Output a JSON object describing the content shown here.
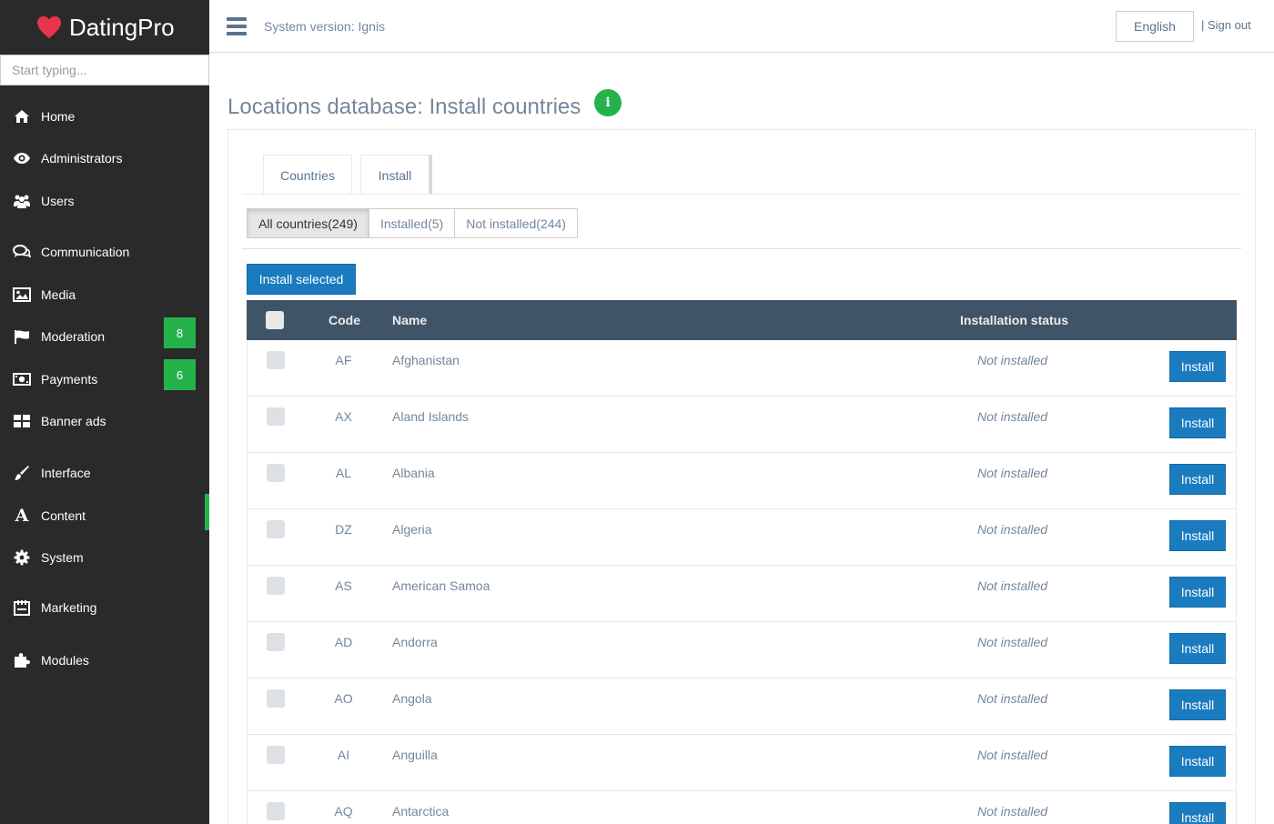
{
  "brand": {
    "name": "DatingPro"
  },
  "sidebar": {
    "search_placeholder": "Start typing...",
    "items": [
      {
        "label": "Home",
        "icon": "home-icon"
      },
      {
        "label": "Administrators",
        "icon": "eye-icon"
      },
      {
        "label": "Users",
        "icon": "users-icon"
      },
      {
        "label": "Communication",
        "icon": "chat-icon"
      },
      {
        "label": "Media",
        "icon": "image-icon"
      },
      {
        "label": "Moderation",
        "icon": "flag-icon",
        "badge": "8"
      },
      {
        "label": "Payments",
        "icon": "money-icon",
        "badge": "6"
      },
      {
        "label": "Banner ads",
        "icon": "grid-icon"
      },
      {
        "label": "Interface",
        "icon": "brush-icon"
      },
      {
        "label": "Content",
        "icon": "font-icon",
        "active": true
      },
      {
        "label": "System",
        "icon": "gear-icon"
      },
      {
        "label": "Marketing",
        "icon": "calendar-icon"
      },
      {
        "label": "Modules",
        "icon": "puzzle-icon"
      }
    ]
  },
  "header": {
    "system_version": "System version: Ignis",
    "language": "English",
    "sign_out": "| Sign out"
  },
  "page": {
    "title": "Locations database: Install countries",
    "info_icon_glyph": "i",
    "tabs": [
      {
        "label": "Countries"
      },
      {
        "label": "Install"
      }
    ],
    "filters": [
      {
        "label": "All countries(249)",
        "active": true
      },
      {
        "label": "Installed(5)"
      },
      {
        "label": "Not installed(244)"
      }
    ],
    "install_selected": "Install selected"
  },
  "table": {
    "columns": {
      "code": "Code",
      "name": "Name",
      "status": "Installation status"
    },
    "rows": [
      {
        "code": "AF",
        "name": "Afghanistan",
        "status": "Not installed",
        "action": "Install"
      },
      {
        "code": "AX",
        "name": "Aland Islands",
        "status": "Not installed",
        "action": "Install"
      },
      {
        "code": "AL",
        "name": "Albania",
        "status": "Not installed",
        "action": "Install"
      },
      {
        "code": "DZ",
        "name": "Algeria",
        "status": "Not installed",
        "action": "Install"
      },
      {
        "code": "AS",
        "name": "American Samoa",
        "status": "Not installed",
        "action": "Install"
      },
      {
        "code": "AD",
        "name": "Andorra",
        "status": "Not installed",
        "action": "Install"
      },
      {
        "code": "AO",
        "name": "Angola",
        "status": "Not installed",
        "action": "Install"
      },
      {
        "code": "AI",
        "name": "Anguilla",
        "status": "Not installed",
        "action": "Install"
      },
      {
        "code": "AQ",
        "name": "Antarctica",
        "status": "Not installed",
        "action": "Install"
      }
    ]
  },
  "colors": {
    "sidebar_bg": "#2a2a2a",
    "accent_green": "#26b24b",
    "primary_blue": "#1a7bbf",
    "table_header": "#405467",
    "heart_red": "#e8344e"
  }
}
